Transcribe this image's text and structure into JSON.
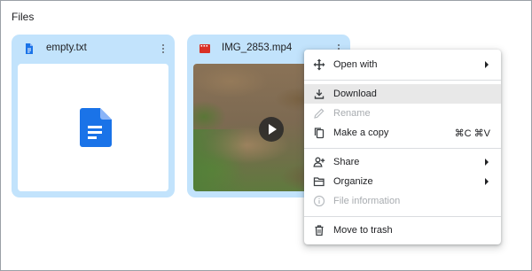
{
  "section_title": "Files",
  "files": [
    {
      "name": "empty.txt",
      "icon": "doc-icon",
      "icon_color": "#1a73e8"
    },
    {
      "name": "IMG_2853.mp4",
      "icon": "video-icon",
      "icon_color": "#d93025"
    }
  ],
  "context_menu": {
    "items": [
      {
        "label": "Open with",
        "icon": "move-icon",
        "enabled": true,
        "submenu": true
      },
      {
        "label": "Download",
        "icon": "download-icon",
        "enabled": true,
        "highlighted": true
      },
      {
        "label": "Rename",
        "icon": "pencil-icon",
        "enabled": false
      },
      {
        "label": "Make a copy",
        "icon": "copy-icon",
        "enabled": true,
        "shortcut": "⌘C ⌘V"
      },
      {
        "label": "Share",
        "icon": "person-add-icon",
        "enabled": true,
        "submenu": true
      },
      {
        "label": "Organize",
        "icon": "folder-open-icon",
        "enabled": true,
        "submenu": true
      },
      {
        "label": "File information",
        "icon": "info-icon",
        "enabled": false
      },
      {
        "label": "Move to trash",
        "icon": "trash-icon",
        "enabled": true
      }
    ]
  },
  "colors": {
    "card_selected_bg": "#c2e3fc",
    "doc_blue": "#1a73e8",
    "video_red": "#d93025",
    "menu_highlight": "#e8e8e8"
  }
}
